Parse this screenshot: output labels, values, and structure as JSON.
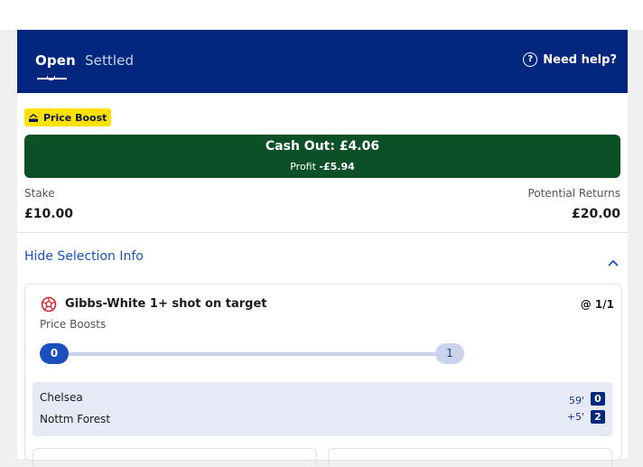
{
  "header": {
    "tabs": [
      {
        "label": "Open",
        "active": true
      },
      {
        "label": "Settled",
        "active": false
      }
    ],
    "help_label": "Need help?",
    "help_icon_glyph": "?",
    "background_color": "#00277d"
  },
  "bet": {
    "badge_label": "Price Boost",
    "cash_out_label": "Cash Out: £4.06",
    "profit_label": "Profit",
    "profit_value": "-£5.94",
    "stake_label": "Stake",
    "stake_value": "£10.00",
    "returns_label": "Potential Returns",
    "returns_value": "£20.00",
    "cash_out_color": "#0b5027",
    "badge_color": "#ffe100"
  },
  "selection_info": {
    "toggle_label": "Hide Selection Info",
    "expanded": true
  },
  "selection": {
    "name": "Gibbs-White 1+ shot on target",
    "odds": "@ 1/1",
    "boost_label": "Price Boosts",
    "progress": {
      "current": "0",
      "target": "1",
      "fraction": 0
    }
  },
  "match": {
    "home_team": "Chelsea",
    "away_team": "Nottm Forest",
    "home_score": "0",
    "away_score": "2",
    "minute": "59'",
    "added_time": "+5'"
  }
}
